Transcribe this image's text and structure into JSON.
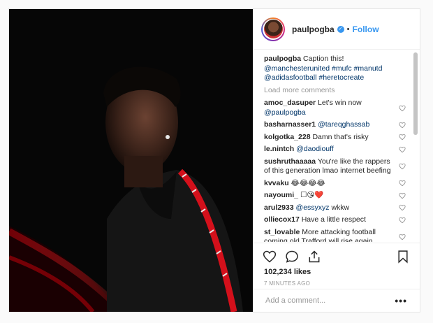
{
  "post": {
    "username": "paulpogba",
    "follow_label": "Follow",
    "separator": "•",
    "verified_symbol": "✓",
    "caption": {
      "username": "paulpogba",
      "text": "Caption this!",
      "tags_line1": "@manchesterunited #mufc #manutd",
      "tags_line2": "@adidasfootball #heretocreate"
    },
    "load_more_label": "Load more comments",
    "comments": [
      {
        "user": "amoc_dasuper",
        "text": "Let's win now",
        "mention": "@paulpogba"
      },
      {
        "user": "basharnasser1",
        "text": "",
        "mention": "@tareqghassab"
      },
      {
        "user": "kolgotka_228",
        "text": "Damn that's risky",
        "mention": ""
      },
      {
        "user": "le.nintch",
        "text": "",
        "mention": "@daodiouff"
      },
      {
        "user": "sushruthaaaaa",
        "text": "You're like the rappers of this generation lmao internet beefing",
        "mention": ""
      },
      {
        "user": "kvvaku",
        "text": "😂😂😂😂",
        "mention": ""
      },
      {
        "user": "nayoumi_",
        "text": "☐😘❤️",
        "mention": ""
      },
      {
        "user": "arul2933",
        "text": "",
        "mention": "@essyxyz",
        "after": "wkkw"
      },
      {
        "user": "olliecox17",
        "text": "Have a little respect",
        "mention": ""
      },
      {
        "user": "st_lovable",
        "text": "More attacking football coming old Trafford will rise again",
        "mention": ""
      }
    ],
    "likes": "102,234 likes",
    "time": "7 MINUTES AGO",
    "add_comment_placeholder": "Add a comment...",
    "more_label": "•••"
  },
  "icons": [
    "heart-icon",
    "comment-icon",
    "share-icon",
    "bookmark-icon",
    "verified-icon"
  ],
  "colors": {
    "accent": "#3897f0",
    "mention": "#003569",
    "muted": "#999999"
  }
}
